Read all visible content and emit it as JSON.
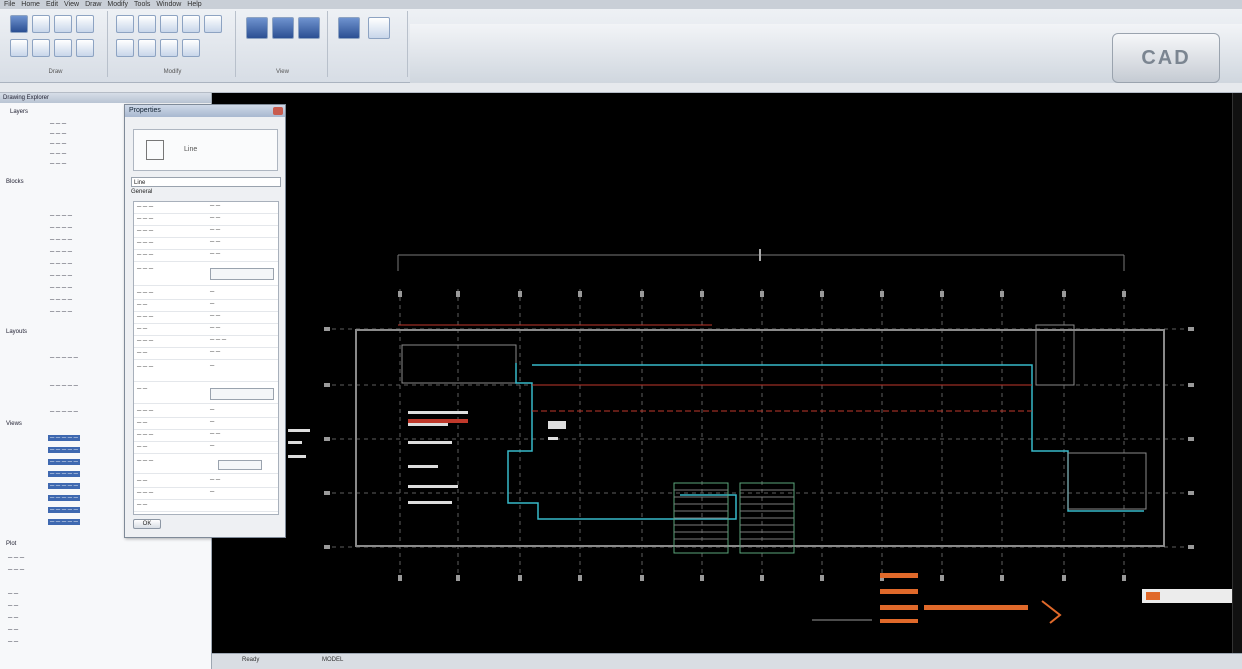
{
  "menu": [
    "File",
    "Home",
    "Edit",
    "View",
    "Draw",
    "Modify",
    "Tools",
    "Window",
    "Help"
  ],
  "ribbon": {
    "groups": [
      {
        "label": "Draw"
      },
      {
        "label": "Modify"
      },
      {
        "label": "View"
      }
    ],
    "logo_text": "CAD"
  },
  "tree": {
    "title": "Drawing Explorer",
    "nodes": [
      "Layers",
      "Blocks",
      "Layouts",
      "Views",
      "Plot"
    ]
  },
  "dialog": {
    "title": "Properties",
    "preview_text": "Line",
    "combo_value": "Line",
    "tabs": "General",
    "ok_label": "OK"
  },
  "status": {
    "coords": "Ready",
    "mode": "MODEL"
  },
  "colors": {
    "canvas_bg": "#000000",
    "grid": "#6b6b6b",
    "cyan_line": "#37b9c9",
    "red_line": "#c0392b",
    "orange_label": "#e0692a",
    "ribbon": "#dfe3e8"
  }
}
